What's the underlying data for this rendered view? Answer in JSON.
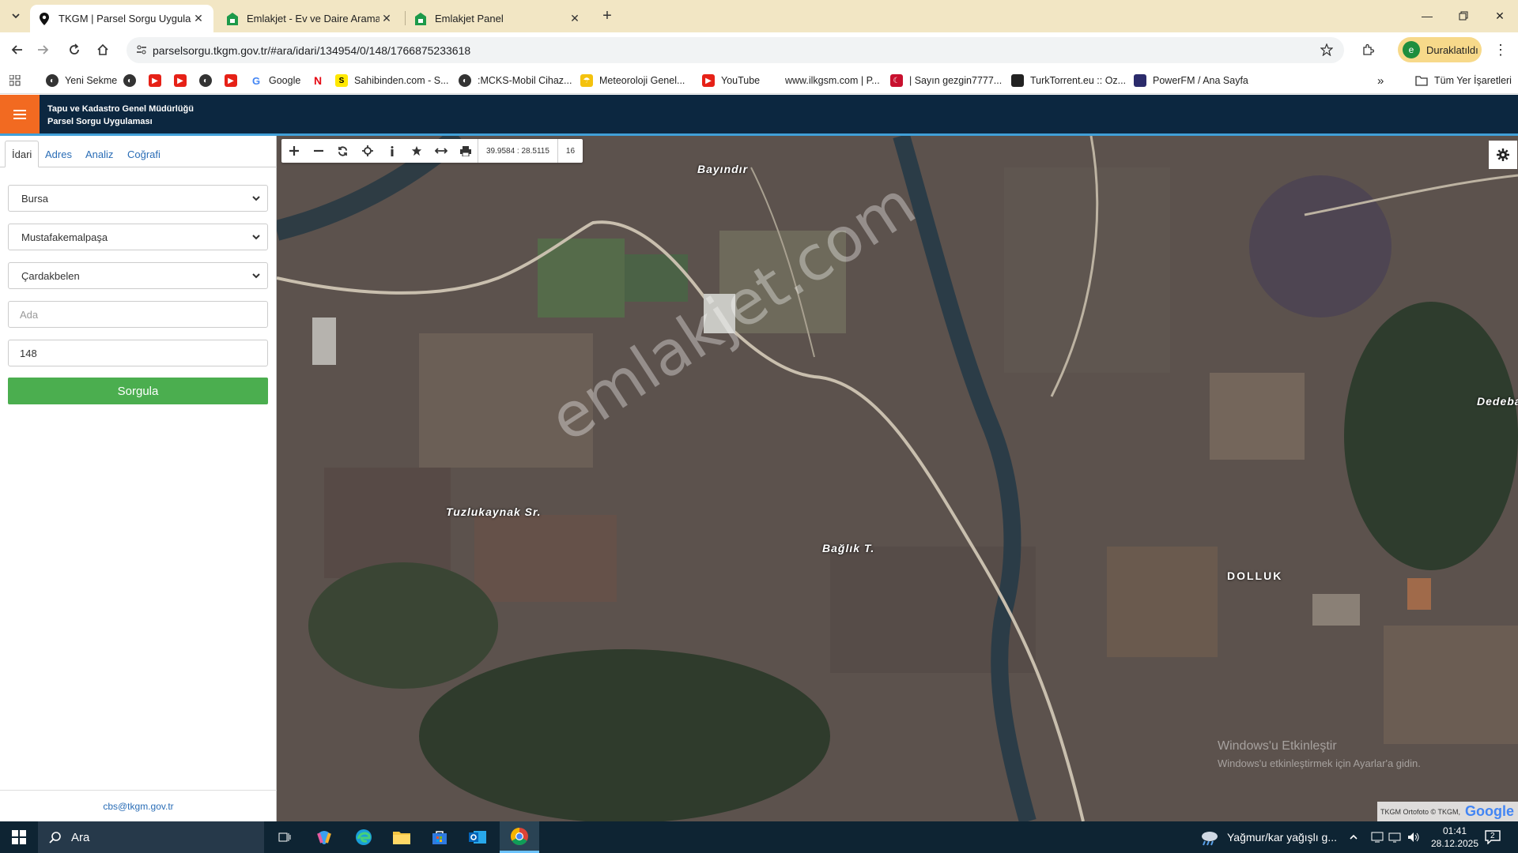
{
  "browser": {
    "tabs": [
      {
        "label": "TKGM | Parsel Sorgu Uygulama",
        "active": true
      },
      {
        "label": "Emlakjet - Ev ve Daire Aramanı",
        "active": false
      },
      {
        "label": "Emlakjet Panel",
        "active": false
      }
    ],
    "url": "parselsorgu.tkgm.gov.tr/#ara/idari/134954/0/148/1766875233618",
    "profile_label": "Duraklatıldı",
    "profile_initial": "e"
  },
  "bookmarks": [
    {
      "label": "Yeni Sekme",
      "icon": "globe-icon"
    },
    {
      "label": "",
      "icon": "globe-icon"
    },
    {
      "label": "",
      "icon": "youtube-icon"
    },
    {
      "label": "",
      "icon": "youtube-icon"
    },
    {
      "label": "",
      "icon": "globe-icon"
    },
    {
      "label": "",
      "icon": "youtube-icon"
    },
    {
      "label": "Google",
      "icon": "google-icon"
    },
    {
      "label": "",
      "icon": "netflix-icon"
    },
    {
      "label": "Sahibinden.com - S...",
      "icon": "sahibinden-icon"
    },
    {
      "label": ":MCKS-Mobil Cihaz...",
      "icon": "globe-icon"
    },
    {
      "label": "Meteoroloji Genel...",
      "icon": "meteoroloji-icon"
    },
    {
      "label": "YouTube",
      "icon": "youtube-icon"
    },
    {
      "label": "www.ilkgsm.com | P...",
      "icon": "page-icon"
    },
    {
      "label": "| Sayın gezgin7777...",
      "icon": "flag-icon"
    },
    {
      "label": "TurkTorrent.eu :: Oz...",
      "icon": "torrent-icon"
    },
    {
      "label": "PowerFM / Ana Sayfa",
      "icon": "powerfm-icon"
    }
  ],
  "bookmarks_folder": "Tüm Yer İşaretleri",
  "app": {
    "title_line1": "Tapu ve Kadastro Genel Müdürlüğü",
    "title_line2": "Parsel Sorgu Uygulaması"
  },
  "sidebar": {
    "tabs": [
      "İdari",
      "Adres",
      "Analiz",
      "Coğrafi"
    ],
    "il": "Bursa",
    "ilce": "Mustafakemalpaşa",
    "mahalle": "Çardakbelen",
    "ada_placeholder": "Ada",
    "parsel_value": "148",
    "submit_label": "Sorgula",
    "footer_email": "cbs@tkgm.gov.tr"
  },
  "map": {
    "coordinates": "39.9584 : 28.5115",
    "zoom": "16",
    "place_labels": [
      "Bayındır",
      "Tuzlukaynak Sr.",
      "Bağlık T.",
      "DOLLUK",
      "Dedeba"
    ],
    "watermark": "emlakjet.com",
    "windows_activation_line1": "Windows'u Etkinleştir",
    "windows_activation_line2": "Windows'u etkinleştirmek için Ayarlar'a gidin.",
    "attribution": "TKGM Ortofoto © TKGM,",
    "attribution_brand": "Google"
  },
  "taskbar": {
    "search_label": "Ara",
    "weather": "Yağmur/kar yağışlı g...",
    "time": "01:41",
    "date": "28.12.2025",
    "notification_count": "2"
  },
  "colors": {
    "header_bg": "#0c2740",
    "menu_orange": "#f26a21",
    "submit_green": "#4bae4f",
    "tab_strip": "#f2e6c4",
    "link_blue": "#2a6db6"
  }
}
